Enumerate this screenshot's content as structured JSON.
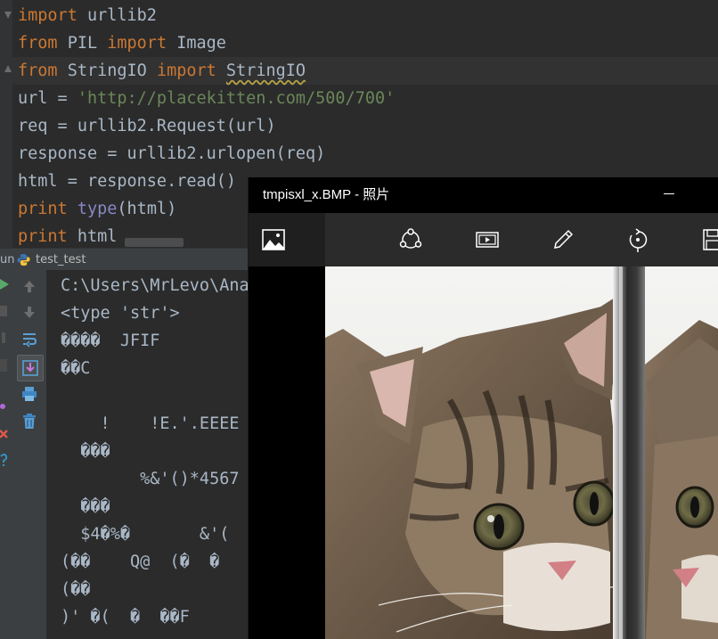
{
  "editor": {
    "lines": [
      {
        "segments": [
          {
            "t": "import",
            "c": "kw"
          },
          {
            "t": " urllib2",
            "c": ""
          }
        ]
      },
      {
        "segments": [
          {
            "t": "from",
            "c": "kw"
          },
          {
            "t": " PIL ",
            "c": ""
          },
          {
            "t": "import",
            "c": "kw"
          },
          {
            "t": " Image",
            "c": ""
          }
        ]
      },
      {
        "segments": [
          {
            "t": "from",
            "c": "kw"
          },
          {
            "t": " StringIO ",
            "c": ""
          },
          {
            "t": "import",
            "c": "kw"
          },
          {
            "t": " ",
            "c": ""
          },
          {
            "t": "StringIO",
            "c": "warn"
          }
        ]
      },
      {
        "segments": [
          {
            "t": "url = ",
            "c": ""
          },
          {
            "t": "'http://placekitten.com/500/700'",
            "c": "str"
          }
        ]
      },
      {
        "segments": [
          {
            "t": "req = urllib2.Request(url)",
            "c": ""
          }
        ]
      },
      {
        "segments": [
          {
            "t": "response = urllib2.urlopen(req)",
            "c": ""
          }
        ]
      },
      {
        "segments": [
          {
            "t": "html = response.read()",
            "c": ""
          }
        ]
      },
      {
        "segments": [
          {
            "t": "print",
            "c": "kw"
          },
          {
            "t": " ",
            "c": ""
          },
          {
            "t": "type",
            "c": "bi"
          },
          {
            "t": "(html)",
            "c": ""
          }
        ]
      },
      {
        "segments": [
          {
            "t": "print",
            "c": "kw"
          },
          {
            "t": " html",
            "c": ""
          }
        ]
      }
    ]
  },
  "run_panel": {
    "label": "un",
    "tab": "test_test"
  },
  "console": {
    "lines": [
      "C:\\Users\\MrLevo\\Ana",
      "<type 'str'>",
      "����  JFIF",
      "��C",
      "",
      "    !    !E.'.EEEE",
      "  ���",
      "        %&'()*4567",
      "  ���",
      "  $4�%�       &'(",
      "(��    Q@  (�  �",
      "(��",
      ")' �(  �  ��F"
    ]
  },
  "photos_window": {
    "title": "tmpisxl_x.BMP - 照片",
    "toolbar_icons": [
      "image-icon",
      "share-icon",
      "slideshow-icon",
      "draw-icon",
      "rotate-icon",
      "save-icon"
    ]
  },
  "colors": {
    "editor_bg": "#2b2b2b",
    "keyword": "#cc7832",
    "string": "#6a8759",
    "builtin": "#8888c6",
    "text": "#a9b7c6"
  }
}
